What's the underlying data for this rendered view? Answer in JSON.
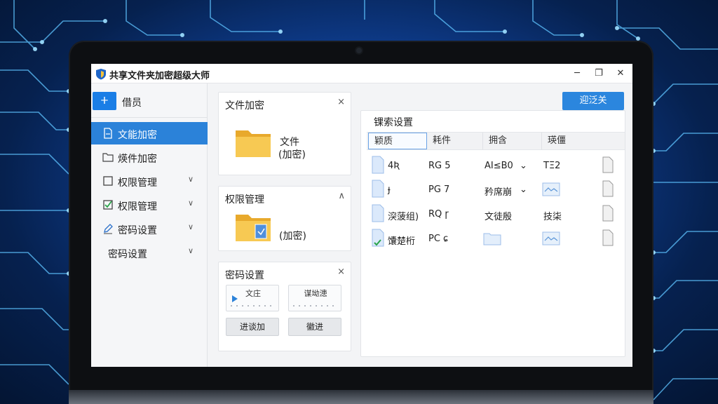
{
  "window": {
    "title": "共享文件夹加密超级大师",
    "minimize": "─",
    "maximize": "❐",
    "close": "✕"
  },
  "sidebar": {
    "user_badge": "ⵜ",
    "user_name": "借员",
    "items": [
      {
        "label": "文能加密",
        "icon": "file-icon",
        "active": true
      },
      {
        "label": "煐件加密",
        "icon": "folder-icon"
      },
      {
        "label": "权限管理",
        "icon": "square-icon",
        "chevron": "∨"
      },
      {
        "label": "权限管理",
        "icon": "checkbox-icon",
        "chevron": "∨"
      },
      {
        "label": "密码设置",
        "icon": "pen-icon",
        "chevron": "∨"
      },
      {
        "label": "密码设置",
        "icon": "",
        "chevron": "∨"
      }
    ]
  },
  "panels": {
    "file_encrypt": {
      "title": "文件加密",
      "close": "×",
      "text_line1": "文件",
      "text_line2": "(加密)"
    },
    "permission": {
      "title": "权限管理",
      "toggle": "∧",
      "text": "(加密)"
    },
    "password": {
      "title": "密码设置",
      "close": "×",
      "card1": "文庄",
      "card2": "谋坳漶",
      "button1": "进谈加",
      "button2": "徽进"
    }
  },
  "right": {
    "top_button": "迎泛关",
    "title": "锞索设置",
    "columns": [
      "颖质",
      "耗件",
      "拥含",
      "瑛僵"
    ],
    "rows": [
      {
        "name": "4Ʀ",
        "c2": "RG 5",
        "c3": "AI≤B0",
        "c3_suffix": "⌄",
        "c4": "TΞ2"
      },
      {
        "name": "ɟ",
        "c2": "PG 7",
        "c3": "矜席崩",
        "c3_suffix": "⌄",
        "c4": ""
      },
      {
        "name": "湥菠组)",
        "c2": "RQ ɼ",
        "c3": "文徒殷",
        "c3_suffix": "",
        "c4": "技柒"
      },
      {
        "name": "馕楚桁",
        "c2": "PC ɕ",
        "c3": "",
        "c3_suffix": "",
        "c4": ""
      }
    ]
  },
  "colors": {
    "accent": "#2b82d9",
    "background": "#0f3f93",
    "folder": "#f5c14a"
  }
}
